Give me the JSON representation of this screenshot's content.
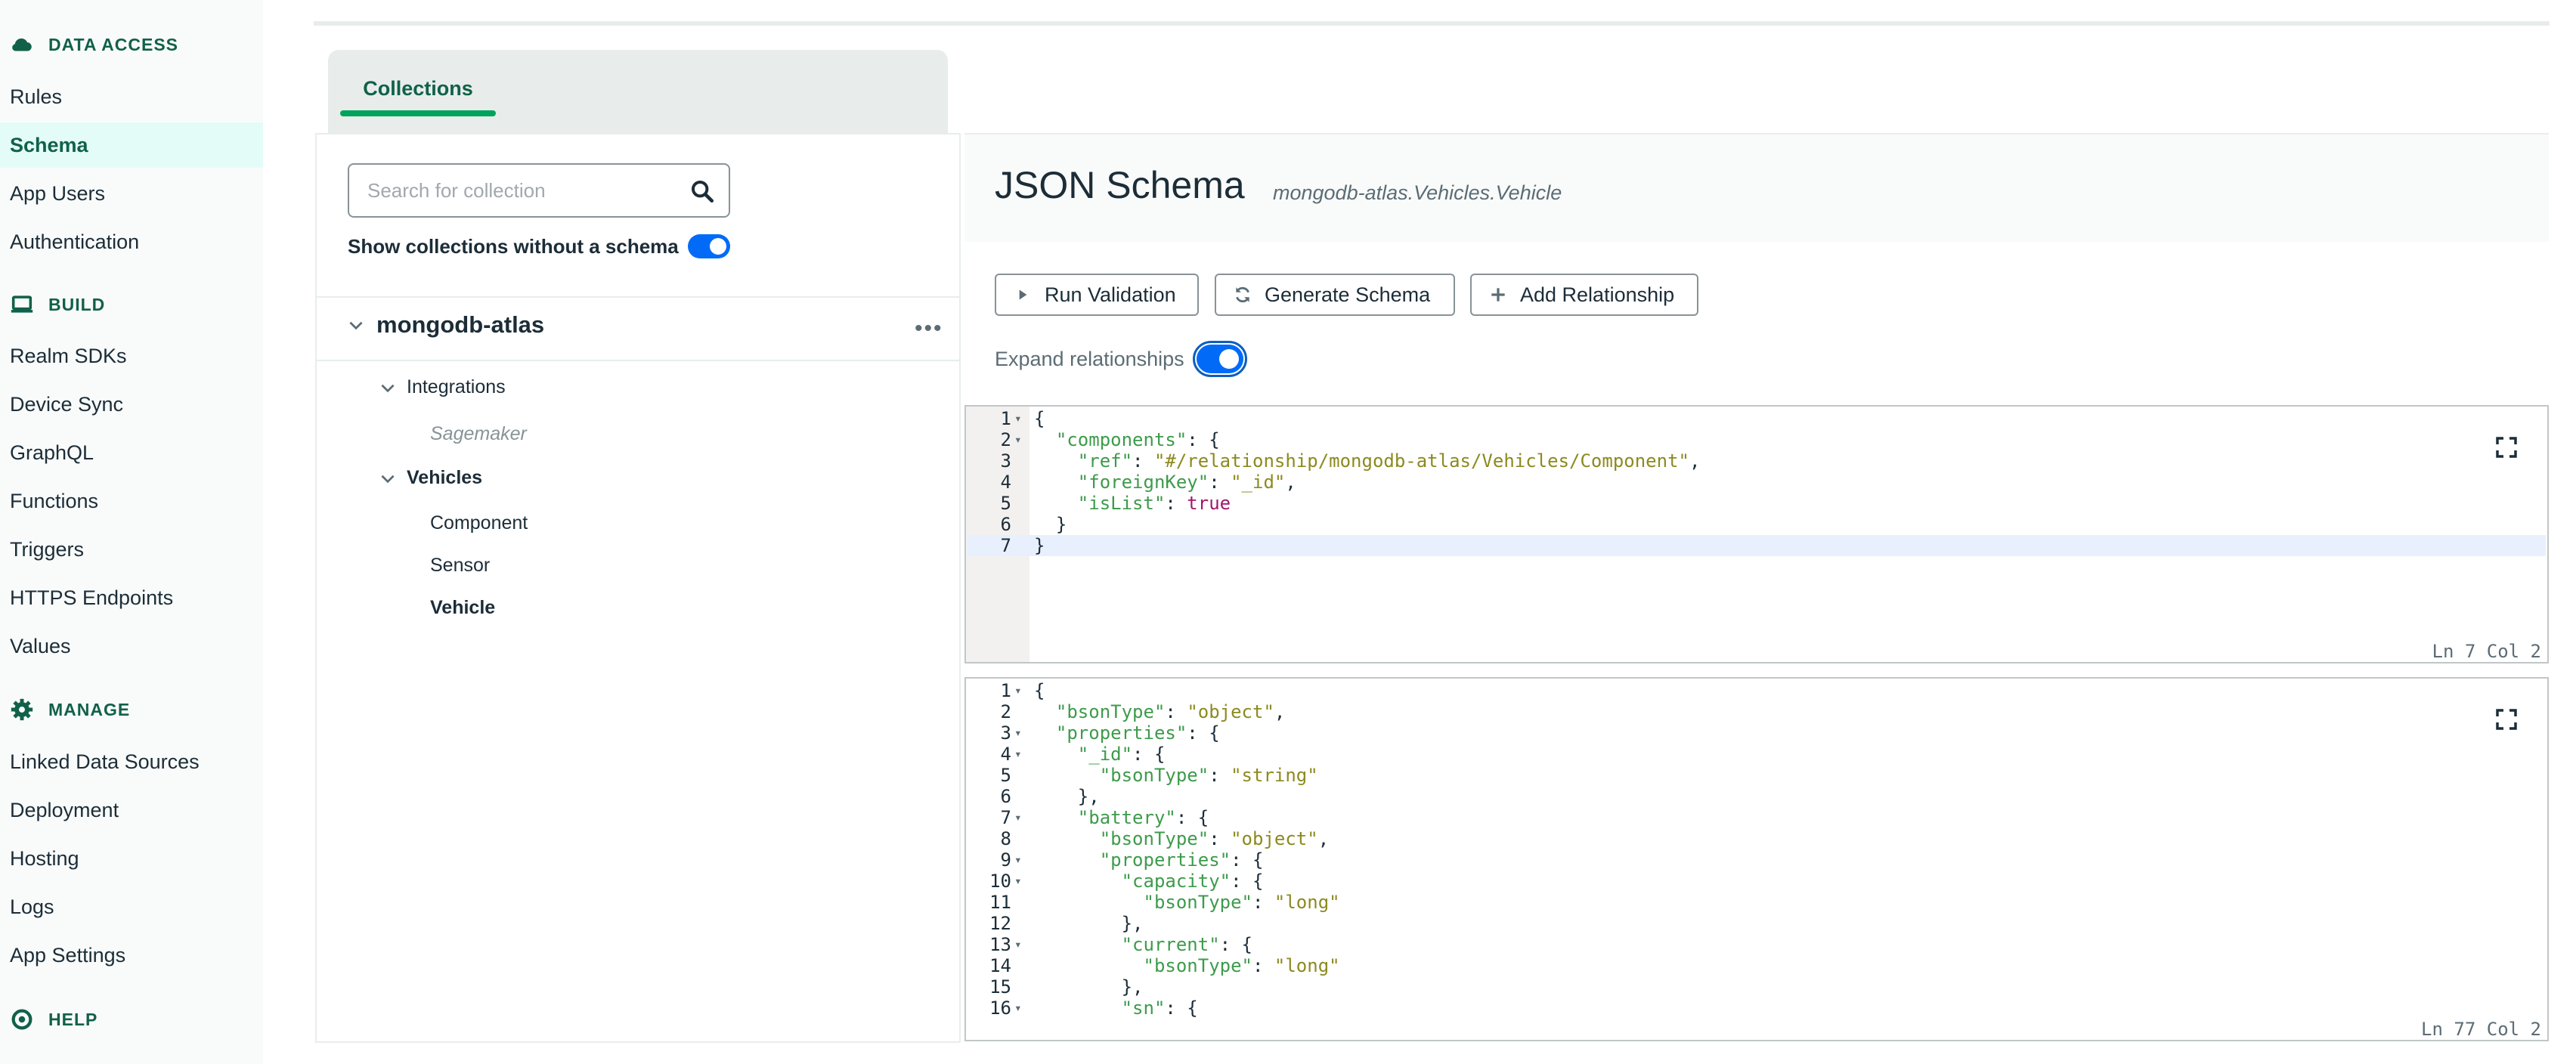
{
  "sidebar": {
    "sections": {
      "data_access": "DATA ACCESS",
      "build": "BUILD",
      "manage": "MANAGE",
      "help": "HELP"
    },
    "data_access_items": [
      "Rules",
      "Schema",
      "App Users",
      "Authentication"
    ],
    "build_items": [
      "Realm SDKs",
      "Device Sync",
      "GraphQL",
      "Functions",
      "Triggers",
      "HTTPS Endpoints",
      "Values"
    ],
    "manage_items": [
      "Linked Data Sources",
      "Deployment",
      "Hosting",
      "Logs",
      "App Settings"
    ],
    "active_item": "Schema"
  },
  "tabs": {
    "collections": "Collections"
  },
  "collections_panel": {
    "search_placeholder": "Search for collection",
    "show_without_schema": "Show collections without a schema",
    "database": "mongodb-atlas",
    "groups": [
      {
        "name": "Integrations",
        "children": [
          "Sagemaker"
        ]
      },
      {
        "name": "Vehicles",
        "children": [
          "Component",
          "Sensor",
          "Vehicle"
        ]
      }
    ]
  },
  "main": {
    "title": "JSON Schema",
    "namespace": "mongodb-atlas.Vehicles.Vehicle",
    "buttons": {
      "run_validation": "Run Validation",
      "generate_schema": "Generate Schema",
      "add_relationship": "Add Relationship"
    },
    "expand_relationships": "Expand relationships"
  },
  "relationship_editor": {
    "status": "Ln 7 Col 2",
    "lines": [
      "{",
      "  \"components\": {",
      "    \"ref\": \"#/relationship/mongodb-atlas/Vehicles/Component\",",
      "    \"foreignKey\": \"_id\",",
      "    \"isList\": true",
      "  }",
      "}"
    ]
  },
  "schema_editor": {
    "status": "Ln 77 Col 2",
    "lines": [
      "{",
      "  \"bsonType\": \"object\",",
      "  \"properties\": {",
      "    \"_id\": {",
      "      \"bsonType\": \"string\"",
      "    },",
      "    \"battery\": {",
      "      \"bsonType\": \"object\",",
      "      \"properties\": {",
      "        \"capacity\": {",
      "          \"bsonType\": \"long\"",
      "        },",
      "        \"current\": {",
      "          \"bsonType\": \"long\"",
      "        },",
      "        \"sn\": {"
    ]
  }
}
